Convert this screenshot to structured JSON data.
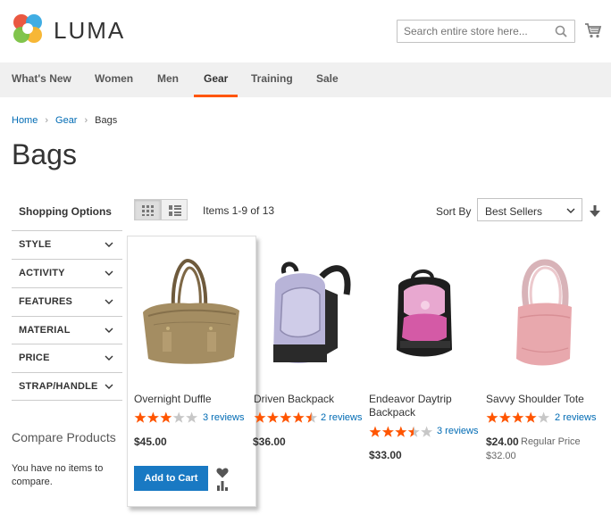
{
  "header": {
    "logo_text": "LUMA",
    "search_placeholder": "Search entire store here...",
    "cart_icon": "cart-icon"
  },
  "nav": {
    "items": [
      {
        "label": "What's New"
      },
      {
        "label": "Women"
      },
      {
        "label": "Men"
      },
      {
        "label": "Gear",
        "active": true
      },
      {
        "label": "Training"
      },
      {
        "label": "Sale"
      }
    ]
  },
  "breadcrumb": {
    "home": "Home",
    "gear": "Gear",
    "current": "Bags"
  },
  "page_title": "Bags",
  "sidebar": {
    "title": "Shopping Options",
    "filters": [
      "STYLE",
      "ACTIVITY",
      "FEATURES",
      "MATERIAL",
      "PRICE",
      "STRAP/HANDLE"
    ],
    "compare_title": "Compare Products",
    "compare_empty": "You have no items to compare."
  },
  "toolbar": {
    "items_count": "Items 1-9 of 13",
    "sort_label": "Sort By",
    "sort_value": "Best Sellers",
    "view_mode": "grid"
  },
  "products": [
    {
      "name": "Overnight Duffle",
      "rating": 3,
      "reviews": "3 reviews",
      "price": "$45.00",
      "add_to_cart": "Add to Cart"
    },
    {
      "name": "Driven Backpack",
      "rating": 4.5,
      "reviews": "2 reviews",
      "price": "$36.00"
    },
    {
      "name": "Endeavor Daytrip Backpack",
      "rating": 3.5,
      "reviews": "3 reviews",
      "price": "$33.00"
    },
    {
      "name": "Savvy Shoulder Tote",
      "rating": 4,
      "reviews": "2 reviews",
      "price": "$24.00",
      "regular_price_label": "Regular Price",
      "old_price": "$32.00"
    }
  ],
  "colors": {
    "accent": "#ff5501",
    "link": "#1979c3",
    "star": "#ff5501"
  }
}
